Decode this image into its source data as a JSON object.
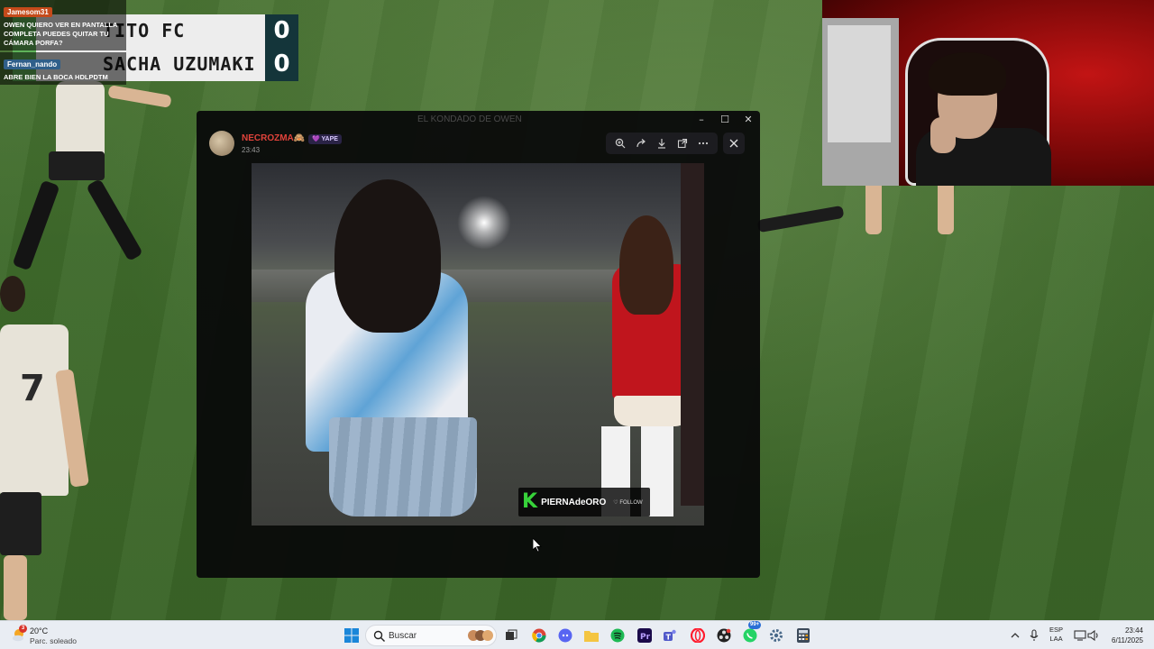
{
  "scoreboard": {
    "team1": "TITO FC",
    "score1": "0",
    "team2": "SACHA UZUMAKI",
    "score2": "0"
  },
  "chat": [
    {
      "user": "Jamesom31",
      "text": "OWEN QUIERO VER EN PANTALLA COMPLETA PUEDES QUITAR TU CÁMARA PORFA?"
    },
    {
      "user": "Fernan_nando",
      "text": "ABRE BIEN LA BOCA HDLPDTM"
    }
  ],
  "viewer": {
    "title": "EL KONDADO DE OWEN",
    "author_name": "NECROZMA🙈",
    "author_badge": "💜 YAPE",
    "timestamp": "23:43",
    "toolbar_icons": [
      "zoom-in-icon",
      "share-icon",
      "download-icon",
      "open-external-icon",
      "more-icon"
    ],
    "close_icon": "close-icon",
    "watermark": {
      "logo": "K",
      "text": "PIERNAdeORO",
      "follow": "♡ FOLLOW"
    }
  },
  "window_controls": [
    "–",
    "☐",
    "✕"
  ],
  "taskbar": {
    "weather_temp": "20°C",
    "weather_condition": "Parc. soleado",
    "weather_badge": "3",
    "search_placeholder": "Buscar",
    "lang_line1": "ESP",
    "lang_line2": "LAA",
    "time": "23:44",
    "date": "6/11/2025",
    "app_badge": "99+"
  },
  "colors": {
    "score_bg": "#14353a",
    "author_color": "#e0433b",
    "taskbar_bg": "#e9edf3",
    "webcam_red": "#c21414"
  }
}
